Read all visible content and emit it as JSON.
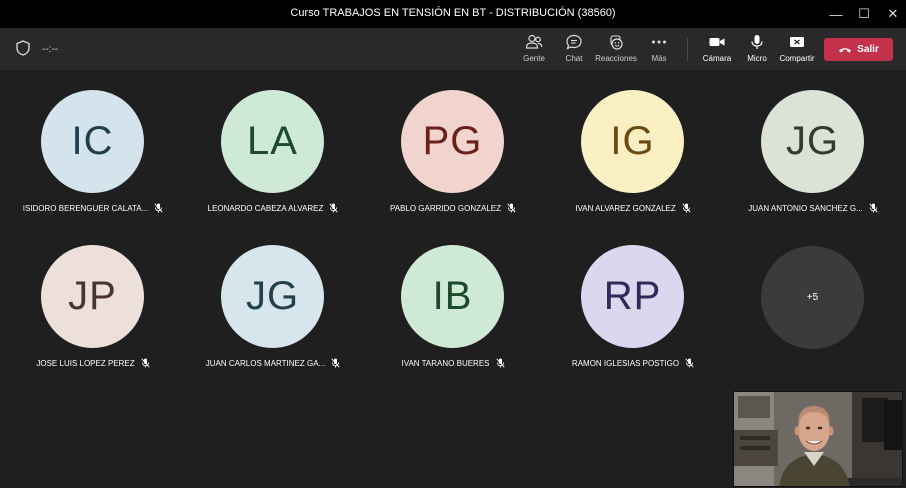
{
  "window": {
    "title": "Curso TRABAJOS EN TENSIÓN EN BT - DISTRIBUCIÓN (38560)",
    "minimize": "—",
    "maximize": "☐",
    "close": "✕"
  },
  "toolbar": {
    "timer": "--:--",
    "people_label": "Gente",
    "chat_label": "Chat",
    "reactions_label": "Reacciones",
    "more_label": "Más",
    "camera_label": "Cámara",
    "mic_label": "Micro",
    "share_label": "Compartir",
    "leave_label": "Salir",
    "leave_color": "#c4314b"
  },
  "participants": [
    {
      "initials": "IC",
      "name": "ISIDORO BERENGUER CALATA...",
      "bg": "#d4e4ec",
      "fg": "#1f3f4d"
    },
    {
      "initials": "LA",
      "name": "LEONARDO CABEZA ALVAREZ",
      "bg": "#cfe9d7",
      "fg": "#1c4a2b"
    },
    {
      "initials": "PG",
      "name": "PABLO GARRIDO GONZALEZ",
      "bg": "#f2d4cf",
      "fg": "#6b2119"
    },
    {
      "initials": "IG",
      "name": "IVAN ALVAREZ GONZALEZ",
      "bg": "#fbefc4",
      "fg": "#6b4a10"
    },
    {
      "initials": "JG",
      "name": "JUAN ANTONIO SANCHEZ G...",
      "bg": "#dbe3d6",
      "fg": "#2f3d29"
    },
    {
      "initials": "JP",
      "name": "JOSE LUIS LOPEZ PEREZ",
      "bg": "#ede0db",
      "fg": "#4a342b"
    },
    {
      "initials": "JG",
      "name": "JUAN CARLOS MARTINEZ GA...",
      "bg": "#d7e6ec",
      "fg": "#23404d"
    },
    {
      "initials": "IB",
      "name": "IVAN TARANO BUERES",
      "bg": "#cfe9d7",
      "fg": "#1c4a2b"
    },
    {
      "initials": "RP",
      "name": "RAMON IGLESIAS POSTIGO",
      "bg": "#dcd7ee",
      "fg": "#2f2a5a"
    }
  ],
  "overflow": {
    "label": "+5"
  }
}
